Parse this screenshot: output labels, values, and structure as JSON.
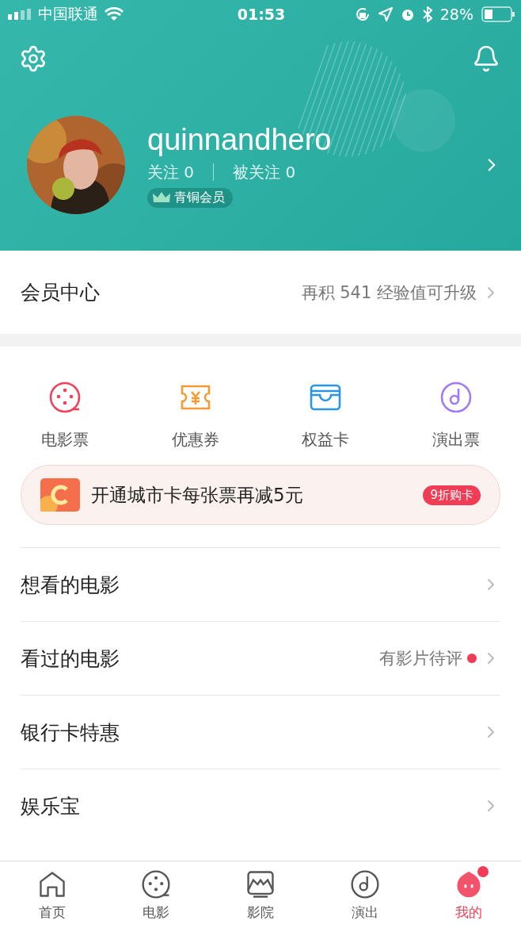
{
  "status_bar": {
    "carrier": "中国联通",
    "time": "01:53",
    "battery": "28%"
  },
  "profile": {
    "username": "quinnandhero",
    "following": "关注 0",
    "followers": "被关注 0",
    "badge": "青铜会员"
  },
  "member_center": {
    "title": "会员中心",
    "hint": "再积 541 经验值可升级"
  },
  "shortcuts": [
    {
      "kind": "film",
      "label": "电影票"
    },
    {
      "kind": "coupon",
      "label": "优惠券"
    },
    {
      "kind": "card",
      "label": "权益卡"
    },
    {
      "kind": "show",
      "label": "演出票"
    }
  ],
  "promo": {
    "text": "开通城市卡每张票再减5元",
    "tag": "9折购卡"
  },
  "menu": [
    {
      "label": "想看的电影",
      "unread": false
    },
    {
      "label": "看过的电影",
      "hint": "有影片待评",
      "unread": true
    },
    {
      "label": "银行卡特惠",
      "unread": false
    },
    {
      "label": "娱乐宝",
      "unread": false
    }
  ],
  "tab_bar": [
    {
      "kind": "home",
      "label": "首页",
      "selected": false,
      "unread": false
    },
    {
      "kind": "film",
      "label": "电影",
      "selected": false,
      "unread": false
    },
    {
      "kind": "cinema",
      "label": "影院",
      "selected": false,
      "unread": false
    },
    {
      "kind": "show",
      "label": "演出",
      "selected": false,
      "unread": false
    },
    {
      "kind": "me",
      "label": "我的",
      "selected": true,
      "unread": true
    }
  ]
}
